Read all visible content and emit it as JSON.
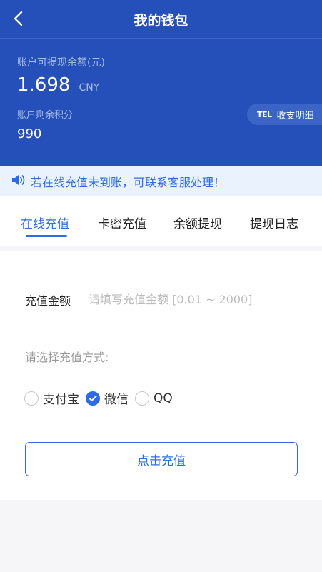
{
  "header": {
    "title": "我的钱包",
    "balance_label": "账户可提现余额(元)",
    "balance_value": "1.698",
    "balance_unit": "CNY",
    "points_label": "账户剩余积分",
    "points_value": "990",
    "detail_icon_text": "TEL",
    "detail_button": "收支明细",
    "background_color": "#2550b9"
  },
  "notice": {
    "icon": "speaker-icon",
    "text": "若在线充值未到账，可联系客服处理！"
  },
  "tabs": [
    {
      "label": "在线充值",
      "active": true
    },
    {
      "label": "卡密充值",
      "active": false
    },
    {
      "label": "余额提现",
      "active": false
    },
    {
      "label": "提现日志",
      "active": false
    }
  ],
  "form": {
    "amount_label": "充值金额",
    "amount_placeholder": "请填写充值金额 [0.01 ~ 2000]",
    "amount_value": "",
    "method_label": "请选择充值方式:",
    "methods": [
      {
        "label": "支付宝",
        "checked": false
      },
      {
        "label": "微信",
        "checked": true
      },
      {
        "label": "QQ",
        "checked": false
      }
    ],
    "submit_label": "点击充值"
  },
  "colors": {
    "accent": "#2d6ce6",
    "notice_bg": "#eaf2fe"
  }
}
